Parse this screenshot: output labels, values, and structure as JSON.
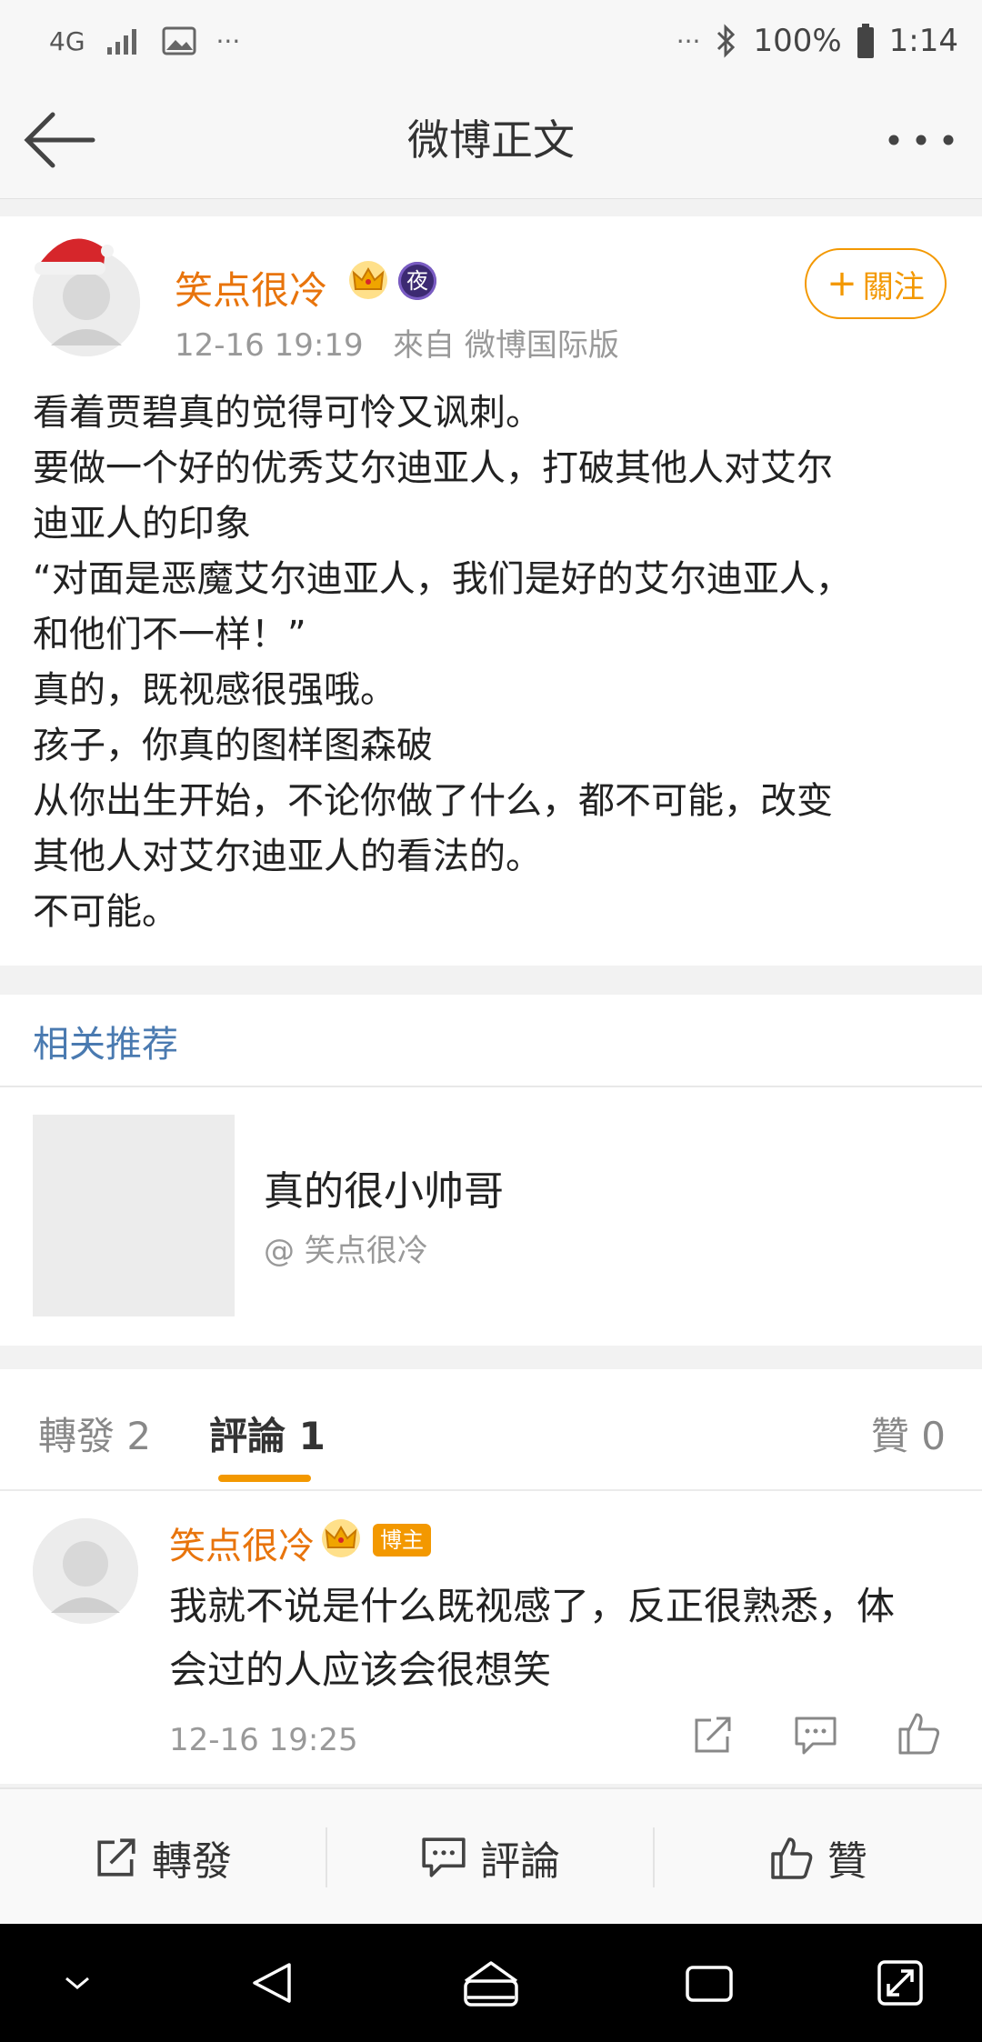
{
  "status_bar": {
    "network": "4G",
    "more": "···",
    "battery": "100%",
    "time": "1:14"
  },
  "nav": {
    "title": "微博正文"
  },
  "post": {
    "user_name": "笑点很冷",
    "night_badge": "夜",
    "meta": "12-16 19:19   來自 微博国际版",
    "follow_label": "關注",
    "follow_plus": "+",
    "text_lines": [
      "看着贾碧真的觉得可怜又讽刺。",
      "要做一个好的优秀艾尔迪亚人，打破其他人对艾尔",
      "迪亚人的印象",
      "“对面是恶魔艾尔迪亚人，我们是好的艾尔迪亚人，",
      "和他们不一样！”",
      "真的，既视感很强哦。",
      "孩子，你真的图样图森破",
      "从你出生开始，不论你做了什么，都不可能，改变",
      "其他人对艾尔迪亚人的看法的。",
      "不可能。"
    ]
  },
  "related": {
    "title": "相关推荐",
    "item_title": "真的很小帅哥",
    "item_author": "@ 笑点很冷"
  },
  "tabs": {
    "repost": "轉發 2",
    "comment": "評論 1",
    "like": "贊 0"
  },
  "comment": {
    "user_name": "笑点很冷",
    "badge": "博主",
    "text_lines": [
      "我就不说是什么既视感了，反正很熟悉，体",
      "会过的人应该会很想笑"
    ],
    "time": "12-16 19:25"
  },
  "actions": {
    "repost": "轉發",
    "comment": "評論",
    "like": "贊"
  },
  "colors": {
    "accent_orange": "#f39800",
    "name_orange": "#e8740c",
    "link_blue": "#4a7ab0"
  }
}
